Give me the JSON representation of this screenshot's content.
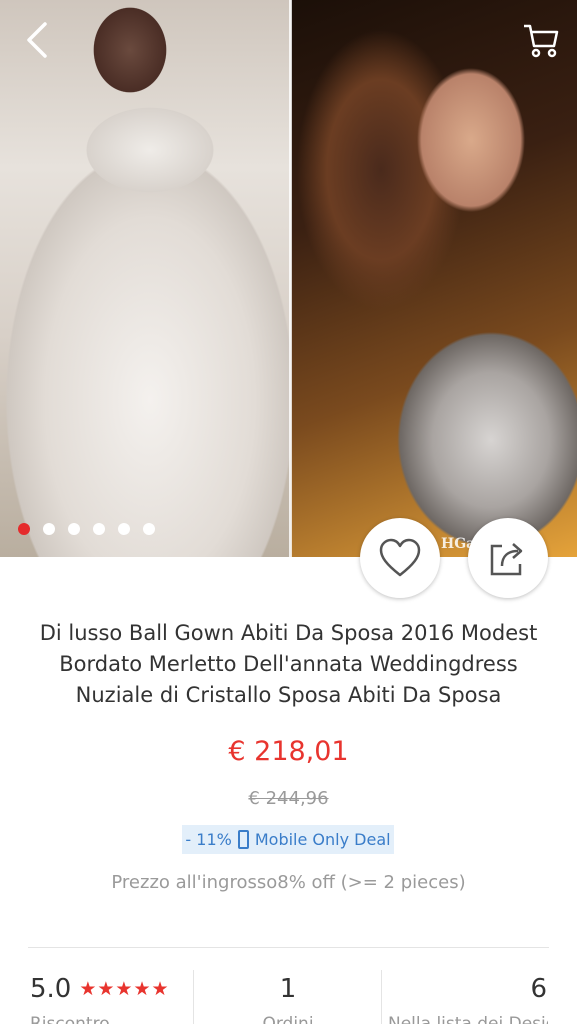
{
  "header": {
    "back_icon": "chevron-left-icon",
    "cart_icon": "cart-icon"
  },
  "gallery": {
    "image_count": 6,
    "active_index": 0,
    "watermark": "HGa"
  },
  "actions": {
    "favorite_icon": "heart-icon",
    "share_icon": "share-icon"
  },
  "product": {
    "title": "Di lusso Ball Gown Abiti Da Sposa 2016 Modest Bordato Merletto Dell'annata Weddingdress Nuziale di Cristallo Sposa Abiti Da Sposa",
    "price": "€ 218,01",
    "original_price": "€ 244,96",
    "discount": "- 11%",
    "deal_label": "Mobile Only Deal",
    "wholesale": "Prezzo all'ingrosso8% off (>= 2 pieces)"
  },
  "stats": {
    "rating": "5.0",
    "stars": "★★★★★",
    "rating_label": "Riscontro",
    "orders": "1",
    "orders_label": "Ordini",
    "wishlist": "6",
    "wishlist_label": "Nella lista dei Desideri"
  },
  "colors": {
    "accent": "#e8342e",
    "deal_bg": "#e3effa",
    "deal_text": "#3a7dc9"
  }
}
